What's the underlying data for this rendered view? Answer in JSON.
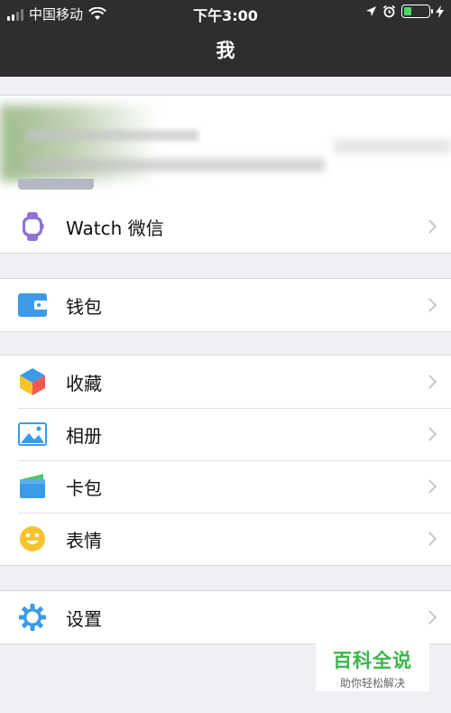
{
  "status_bar": {
    "carrier": "中国移动",
    "time": "下午3:00"
  },
  "nav": {
    "title": "我"
  },
  "menu": {
    "watch": "Watch 微信",
    "wallet": "钱包",
    "favorites": "收藏",
    "album": "相册",
    "cards": "卡包",
    "stickers": "表情",
    "settings": "设置"
  },
  "watermark": {
    "title": "百科全说",
    "subtitle": "助你轻松解决"
  },
  "colors": {
    "nav_bg": "#2e2e30",
    "page_bg": "#efeff4",
    "battery_green": "#4cd964",
    "accent_blue": "#3b9be8",
    "brand_green": "#3ab54a"
  },
  "battery_level": 0.3
}
